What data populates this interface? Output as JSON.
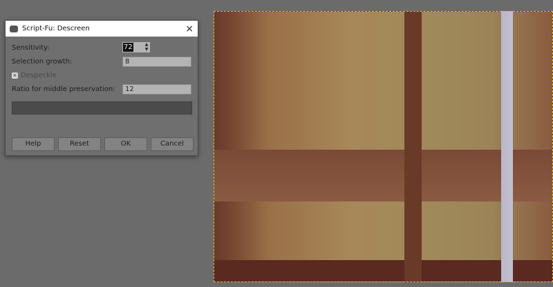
{
  "dialog": {
    "title": "Script-Fu: Descreen",
    "sensitivity_label": "Sensitivity:",
    "sensitivity_value": "72",
    "selection_growth_label": "Selection growth:",
    "selection_growth_value": "8",
    "despeckle_label": "Despeckle",
    "despeckle_checked": true,
    "ratio_label": "Ratio for middle preservation:",
    "ratio_value": "12",
    "buttons": {
      "help": "Help",
      "reset": "Reset",
      "ok": "OK",
      "cancel": "Cancel"
    }
  },
  "icons": {
    "close": "×",
    "check": "✕",
    "spin_up": "▲",
    "spin_down": "▼"
  }
}
